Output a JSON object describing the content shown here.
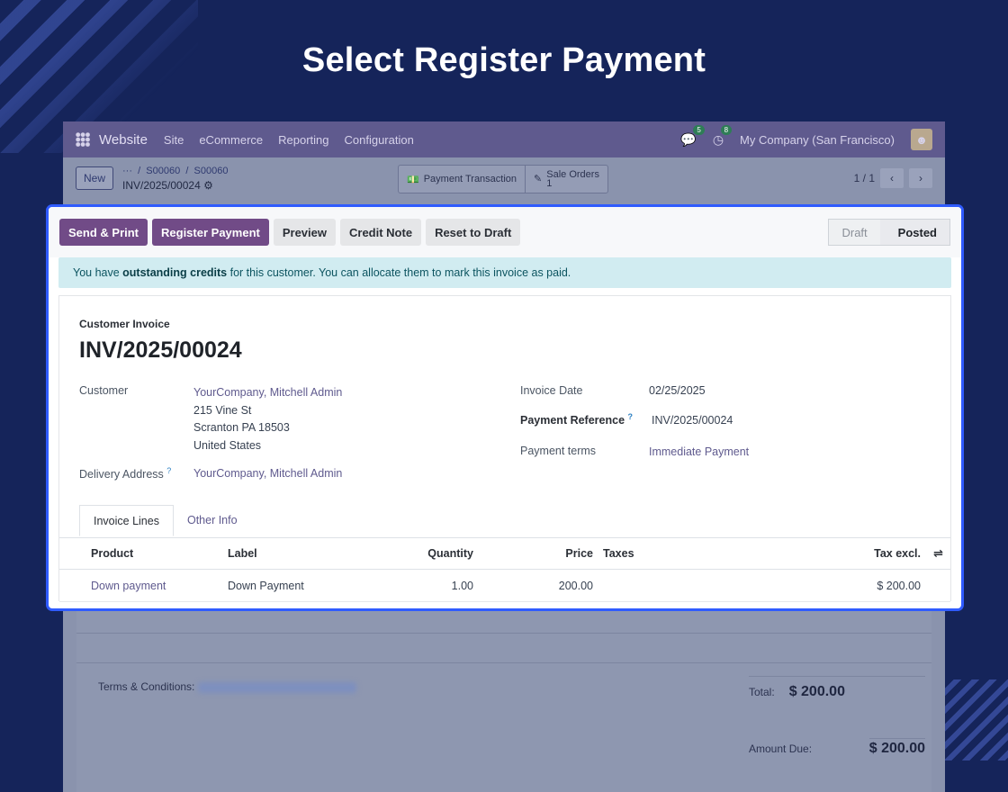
{
  "heading": "Select Register Payment",
  "topnav": {
    "brand": "Website",
    "items": [
      "Site",
      "eCommerce",
      "Reporting",
      "Configuration"
    ],
    "messages_badge": "5",
    "activities_badge": "8",
    "company": "My Company (San Francisco)"
  },
  "control": {
    "new_label": "New",
    "breadcrumb_dots": "···",
    "breadcrumb_1": "S00060",
    "breadcrumb_2": "S00060",
    "record_name": "INV/2025/00024",
    "smart_payment": "Payment Transaction",
    "smart_sales": "Sale Orders",
    "smart_sales_count": "1",
    "pager": "1 / 1"
  },
  "actions": {
    "send_print": "Send & Print",
    "register_payment": "Register Payment",
    "preview": "Preview",
    "credit_note": "Credit Note",
    "reset_draft": "Reset to Draft"
  },
  "status": {
    "draft": "Draft",
    "posted": "Posted"
  },
  "alert": {
    "pre": "You have ",
    "bold": "outstanding credits",
    "post": " for this customer. You can allocate them to mark this invoice as paid."
  },
  "invoice": {
    "type": "Customer Invoice",
    "name": "INV/2025/00024",
    "customer_label": "Customer",
    "customer": "YourCompany, Mitchell Admin",
    "address": [
      "215 Vine St",
      "Scranton PA 18503",
      "United States"
    ],
    "delivery_label": "Delivery Address",
    "delivery": "YourCompany, Mitchell Admin",
    "invoice_date_label": "Invoice Date",
    "invoice_date": "02/25/2025",
    "payment_ref_label": "Payment Reference",
    "payment_ref": "INV/2025/00024",
    "payment_terms_label": "Payment terms",
    "payment_terms": "Immediate Payment"
  },
  "tabs": [
    "Invoice Lines",
    "Other Info"
  ],
  "table": {
    "headers": {
      "product": "Product",
      "label": "Label",
      "quantity": "Quantity",
      "price": "Price",
      "taxes": "Taxes",
      "tax_excl": "Tax excl."
    },
    "rows": [
      {
        "product": "Down payment",
        "label": "Down Payment",
        "quantity": "1.00",
        "price": "200.00",
        "taxes": "",
        "tax_excl": "$ 200.00"
      }
    ]
  },
  "footer": {
    "terms_label": "Terms & Conditions:",
    "total_label": "Total:",
    "total": "$ 200.00",
    "amount_due_label": "Amount Due:",
    "amount_due": "$ 200.00"
  },
  "colors": {
    "background": "#15245a",
    "highlight": "#2f5bff",
    "primary": "#714b87",
    "alert_bg": "#d1ecf1"
  }
}
